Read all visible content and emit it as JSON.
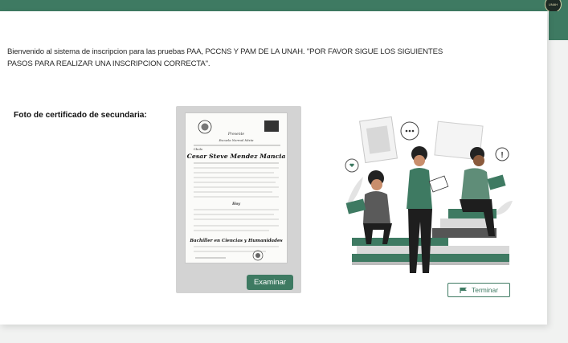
{
  "header": {
    "logo_text": "UNAH"
  },
  "intro": {
    "text": "Bienvenido al sistema de inscripcion para las pruebas PAA, PCCNS Y PAM DE LA UNAH. \"POR FAVOR SIGUE LOS SIGUIENTES PASOS PARA REALIZAR UNA INSCRIPCION CORRECTA\"."
  },
  "upload": {
    "label": "Foto de certificado de secundaria:",
    "button_label": "Examinar",
    "certificate": {
      "header_text": "Presente",
      "school": "Escuela Normal Mixta",
      "name": "Cesar Steve Mendez Mancia",
      "merit": "Bachiller en Ciencias y Humanidades",
      "grade": "Hoy",
      "level": "Cholo"
    }
  },
  "actions": {
    "finish_label": "Terminar",
    "finish_icon": "flag-icon"
  },
  "colors": {
    "accent": "#3e7a62",
    "panel": "#d3d3d3"
  }
}
